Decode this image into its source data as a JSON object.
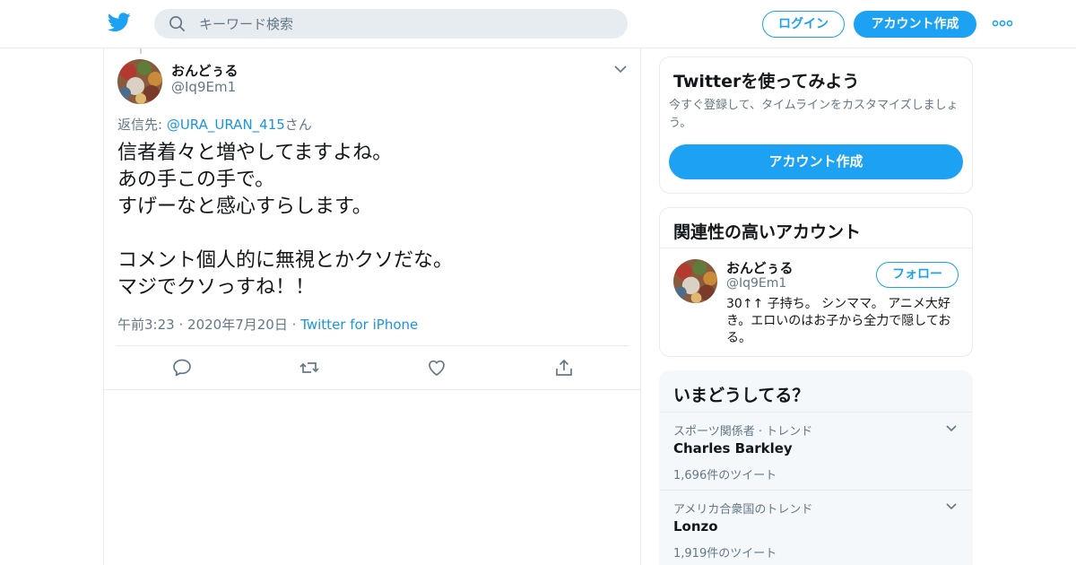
{
  "colors": {
    "accent": "#1da1f2",
    "link": "#1b95e0",
    "muted": "#657786",
    "border": "#e6ecf0",
    "text": "#14171a"
  },
  "header": {
    "logo_icon": "twitter-bird-icon",
    "search_placeholder": "キーワード検索",
    "login_label": "ログイン",
    "signup_label": "アカウント作成",
    "more_icon": "more-dots-icon"
  },
  "tweet": {
    "display_name": "おんどぅる",
    "handle": "@Iq9Em1",
    "reply_prefix": "返信先: ",
    "reply_mention": "@URA_URAN_415",
    "reply_suffix": "さん",
    "text": "信者着々と増やしてますよね。\nあの手この手で。\nすげーなと感心すらします。\n\nコメント個人的に無視とかクソだな。\nマジでクソっすね！！",
    "time": "午前3:23",
    "date": "2020年7月20日",
    "source": "Twitter for iPhone",
    "actions": [
      "reply-icon",
      "retweet-icon",
      "like-icon",
      "share-icon"
    ]
  },
  "signup_card": {
    "title": "Twitterを使ってみよう",
    "description": "今すぐ登録して、タイムラインをカスタマイズしましょう。",
    "button": "アカウント作成"
  },
  "related_card": {
    "title": "関連性の高いアカウント",
    "account": {
      "display_name": "おんどぅる",
      "handle": "@Iq9Em1",
      "follow_label": "フォロー",
      "bio": "30↑↑ 子持ち。 シンママ。 アニメ大好き。エロいのはお子から全力で隠しておる。"
    }
  },
  "trends_card": {
    "title": "いまどうしてる？",
    "items": [
      {
        "context": "スポーツ関係者 · トレンド",
        "name": "Charles Barkley",
        "count": "1,696件のツイート"
      },
      {
        "context": "アメリカ合衆国のトレンド",
        "name": "Lonzo",
        "count": "1,919件のツイート"
      }
    ]
  }
}
